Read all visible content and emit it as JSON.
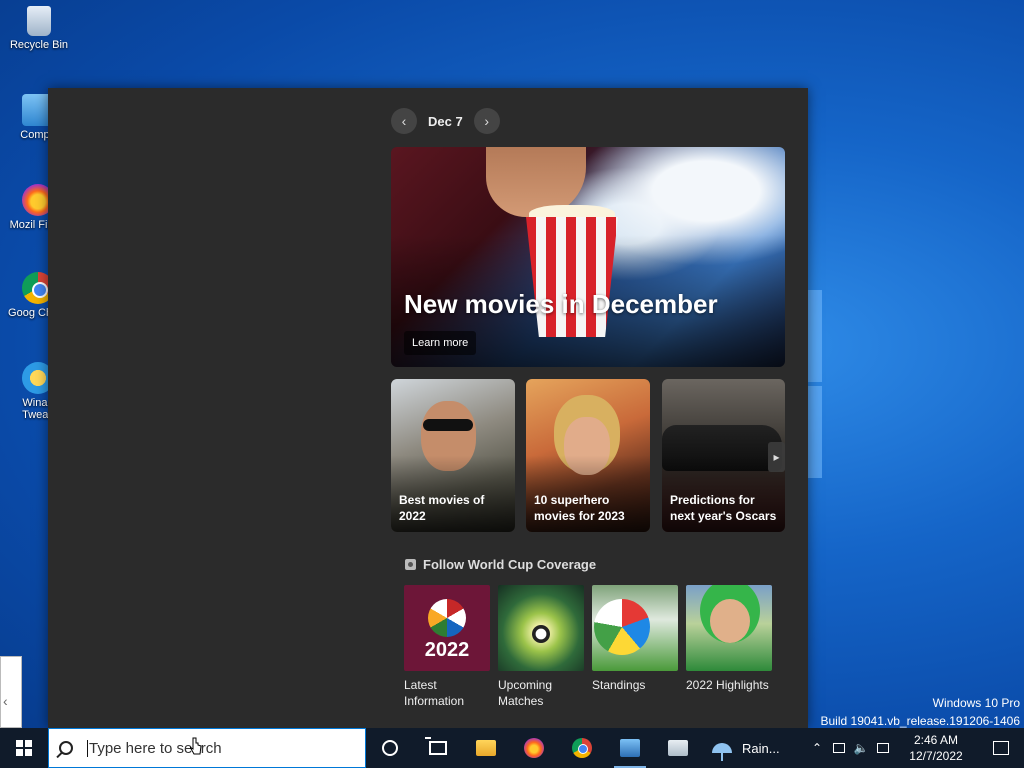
{
  "desktop": {
    "icons": [
      {
        "label": "Recycle Bin"
      },
      {
        "label": "Compu"
      },
      {
        "label": "Mozil Firefo"
      },
      {
        "label": "Goog Chron"
      },
      {
        "label": "Winae Tweak"
      }
    ]
  },
  "widgets": {
    "date": "Dec 7",
    "hero": {
      "title": "New movies in December",
      "button": "Learn more"
    },
    "cards": [
      {
        "caption": "Best movies of 2022"
      },
      {
        "caption": "10 superhero movies for 2023"
      },
      {
        "caption": "Predictions for next year's Oscars"
      }
    ],
    "worldcup": {
      "header": "Follow World Cup Coverage",
      "tile1_year": "2022",
      "tiles": [
        {
          "label": "Latest Information"
        },
        {
          "label": "Upcoming Matches"
        },
        {
          "label": "Standings"
        },
        {
          "label": "2022 Highlights"
        }
      ]
    }
  },
  "watermark": {
    "line1": "Windows 10 Pro",
    "line2": "Build 19041.vb_release.191206-1406"
  },
  "taskbar": {
    "search_placeholder": "Type here to search",
    "weather": "Rain...",
    "time": "2:46 AM",
    "date": "12/7/2022"
  },
  "colors": {
    "taskbar": "#101b2a",
    "panel": "#2b2b2b",
    "accent": "#0078d7"
  }
}
